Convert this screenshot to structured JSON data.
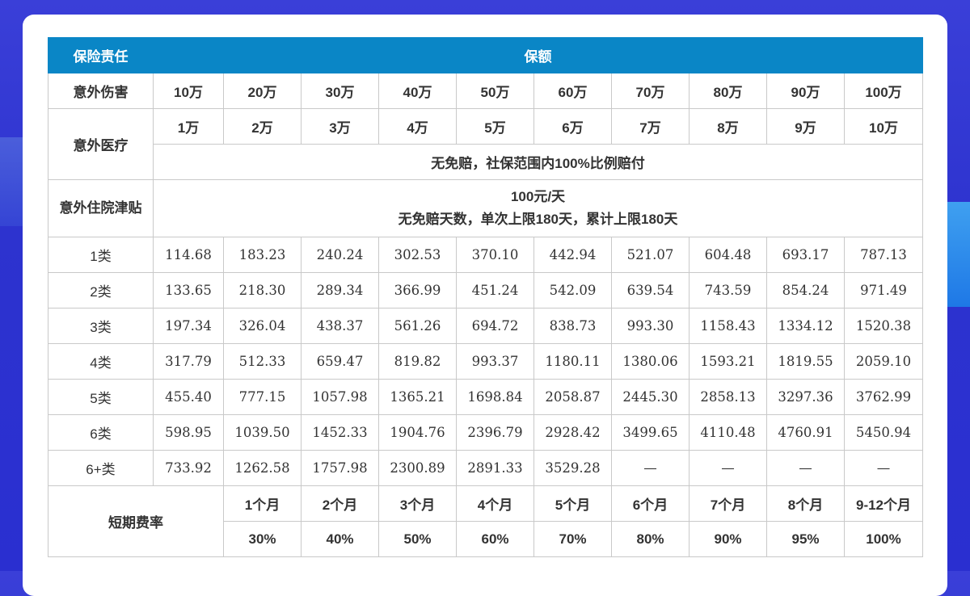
{
  "header": {
    "col1": "保险责任",
    "col2": "保额"
  },
  "accident_injury": {
    "label": "意外伤害",
    "values": [
      "10万",
      "20万",
      "30万",
      "40万",
      "50万",
      "60万",
      "70万",
      "80万",
      "90万",
      "100万"
    ]
  },
  "accident_medical": {
    "label": "意外医疗",
    "values": [
      "1万",
      "2万",
      "3万",
      "4万",
      "5万",
      "6万",
      "7万",
      "8万",
      "9万",
      "10万"
    ],
    "note": "无免赔，社保范围内100%比例赔付"
  },
  "hospital_allowance": {
    "label": "意外住院津贴",
    "line1": "100元/天",
    "line2": "无免赔天数，单次上限180天，累计上限180天"
  },
  "premium_rows": [
    {
      "label": "1类",
      "values": [
        "114.68",
        "183.23",
        "240.24",
        "302.53",
        "370.10",
        "442.94",
        "521.07",
        "604.48",
        "693.17",
        "787.13"
      ]
    },
    {
      "label": "2类",
      "values": [
        "133.65",
        "218.30",
        "289.34",
        "366.99",
        "451.24",
        "542.09",
        "639.54",
        "743.59",
        "854.24",
        "971.49"
      ]
    },
    {
      "label": "3类",
      "values": [
        "197.34",
        "326.04",
        "438.37",
        "561.26",
        "694.72",
        "838.73",
        "993.30",
        "1158.43",
        "1334.12",
        "1520.38"
      ]
    },
    {
      "label": "4类",
      "values": [
        "317.79",
        "512.33",
        "659.47",
        "819.82",
        "993.37",
        "1180.11",
        "1380.06",
        "1593.21",
        "1819.55",
        "2059.10"
      ]
    },
    {
      "label": "5类",
      "values": [
        "455.40",
        "777.15",
        "1057.98",
        "1365.21",
        "1698.84",
        "2058.87",
        "2445.30",
        "2858.13",
        "3297.36",
        "3762.99"
      ]
    },
    {
      "label": "6类",
      "values": [
        "598.95",
        "1039.50",
        "1452.33",
        "1904.76",
        "2396.79",
        "2928.42",
        "3499.65",
        "4110.48",
        "4760.91",
        "5450.94"
      ]
    },
    {
      "label": "6+类",
      "values": [
        "733.92",
        "1262.58",
        "1757.98",
        "2300.89",
        "2891.33",
        "3529.28",
        "—",
        "—",
        "—",
        "—"
      ]
    }
  ],
  "short_term": {
    "label": "短期费率",
    "periods": [
      "1个月",
      "2个月",
      "3个月",
      "4个月",
      "5个月",
      "6个月",
      "7个月",
      "8个月",
      "9-12个月"
    ],
    "rates": [
      "30%",
      "40%",
      "50%",
      "60%",
      "70%",
      "80%",
      "90%",
      "95%",
      "100%"
    ]
  }
}
